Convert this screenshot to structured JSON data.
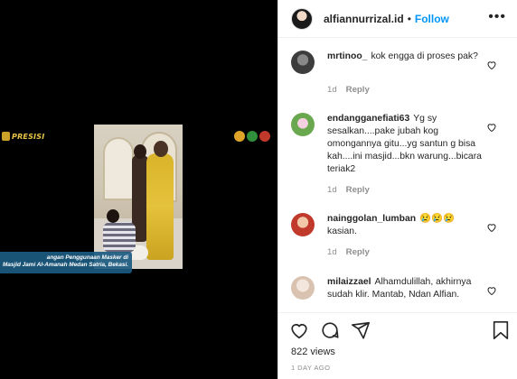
{
  "media": {
    "logo_left_text": "PRESISI",
    "caption_line1": "angan Penggunaan Masker di",
    "caption_line2": "Masjid Jami Al-Amanah Medan Satria, Bekasi."
  },
  "header": {
    "username": "alfiannurrizal.id",
    "separator": "•",
    "follow_label": "Follow",
    "more_label": "•••"
  },
  "comments": [
    {
      "username": "mrtinoo_",
      "text": "kok engga di proses pak?",
      "age": "1d",
      "reply_label": "Reply",
      "avatar_color": "#3d3d3d"
    },
    {
      "username": "endangganefiati63",
      "text": "Yg sy sesalkan....pake jubah kog omongannya gitu...yg santun g bisa kah....ini masjid...bkn warung...bicara teriak2",
      "age": "1d",
      "reply_label": "Reply",
      "avatar_color": "#6aa84f"
    },
    {
      "username": "nainggolan_lumban",
      "text": "😢😢😢 kasian.",
      "age": "1d",
      "reply_label": "Reply",
      "avatar_color": "#c0392b"
    },
    {
      "username": "milaizzael",
      "text": "Alhamdulillah, akhirnya sudah klir. Mantab, Ndan Alfian.",
      "age": "",
      "reply_label": "",
      "avatar_color": "#d9c3b0"
    }
  ],
  "actions": {
    "views": "822 views",
    "date": "1 DAY AGO"
  },
  "colors": {
    "accent": "#0095f6",
    "caption_bg": "#1b5a80",
    "logo_gold": "#e8c547"
  },
  "icons": [
    "heart-icon",
    "comment-icon",
    "share-icon",
    "bookmark-icon",
    "more-icon"
  ]
}
